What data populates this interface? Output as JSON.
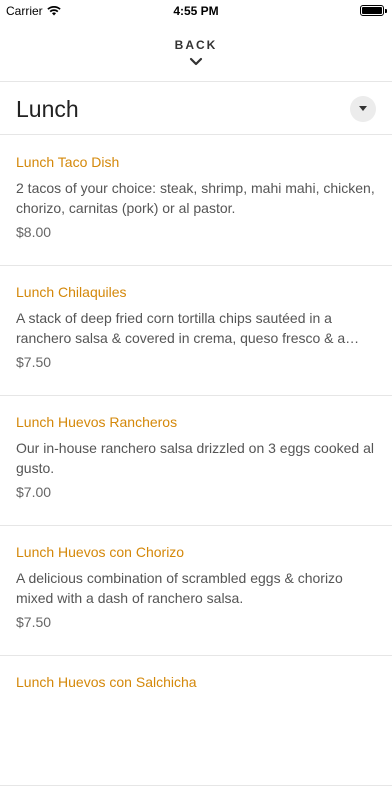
{
  "status": {
    "carrier": "Carrier",
    "time": "4:55 PM"
  },
  "nav": {
    "back_label": "BACK"
  },
  "section": {
    "title": "Lunch"
  },
  "items": [
    {
      "name": "Lunch Taco Dish",
      "description": "2 tacos of your choice: steak, shrimp, mahi mahi, chicken, chorizo, carnitas (pork) or al pastor.",
      "price": "$8.00"
    },
    {
      "name": "Lunch Chilaquiles",
      "description": "A stack of deep fried corn tortilla chips sautéed in a ranchero salsa & covered in crema, queso fresco & a das...",
      "price": "$7.50"
    },
    {
      "name": "Lunch Huevos Rancheros",
      "description": "Our in-house ranchero salsa drizzled on 3 eggs cooked al gusto.",
      "price": "$7.00"
    },
    {
      "name": "Lunch Huevos con Chorizo",
      "description": "A delicious combination of scrambled eggs & chorizo mixed with a dash of ranchero salsa.",
      "price": "$7.50"
    },
    {
      "name": "Lunch Huevos con Salchicha",
      "description": "",
      "price": ""
    }
  ],
  "colors": {
    "item_name": "#d4880a",
    "divider": "#e6e6e6"
  }
}
